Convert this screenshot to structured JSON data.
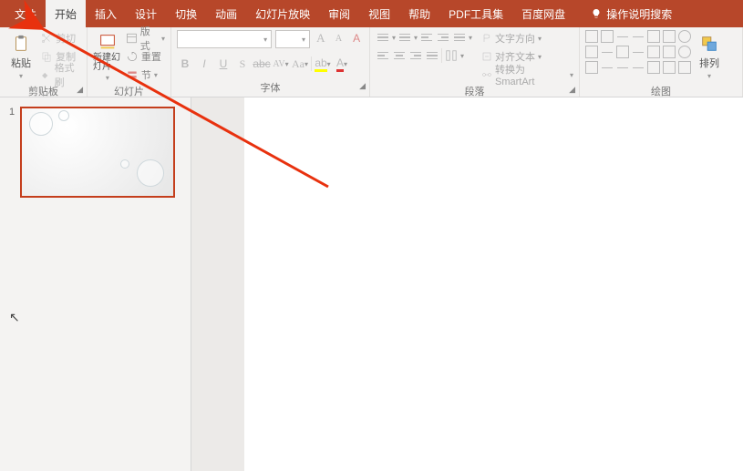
{
  "tabs": {
    "file": "文件",
    "home": "开始",
    "insert": "插入",
    "design": "设计",
    "transitions": "切换",
    "animations": "动画",
    "slideshow": "幻灯片放映",
    "review": "审阅",
    "view": "视图",
    "help": "帮助",
    "pdftools": "PDF工具集",
    "baidu": "百度网盘",
    "tellme": "操作说明搜索"
  },
  "clipboard": {
    "paste": "粘贴",
    "cut": "剪切",
    "copy": "复制",
    "formatpainter": "格式刷",
    "group": "剪贴板"
  },
  "slides": {
    "newslide": "新建幻灯片",
    "layout": "版式",
    "reset": "重置",
    "section": "节",
    "group": "幻灯片"
  },
  "font": {
    "name_placeholder": "",
    "size_placeholder": "",
    "growA": "A",
    "shrinkA": "A",
    "clear": "A",
    "group": "字体"
  },
  "paragraph": {
    "textdir": "文字方向",
    "align": "对齐文本",
    "smartart": "转换为 SmartArt",
    "group": "段落"
  },
  "drawing": {
    "arrange": "排列",
    "group": "绘图"
  },
  "thumb": {
    "slideNumber": "1"
  }
}
